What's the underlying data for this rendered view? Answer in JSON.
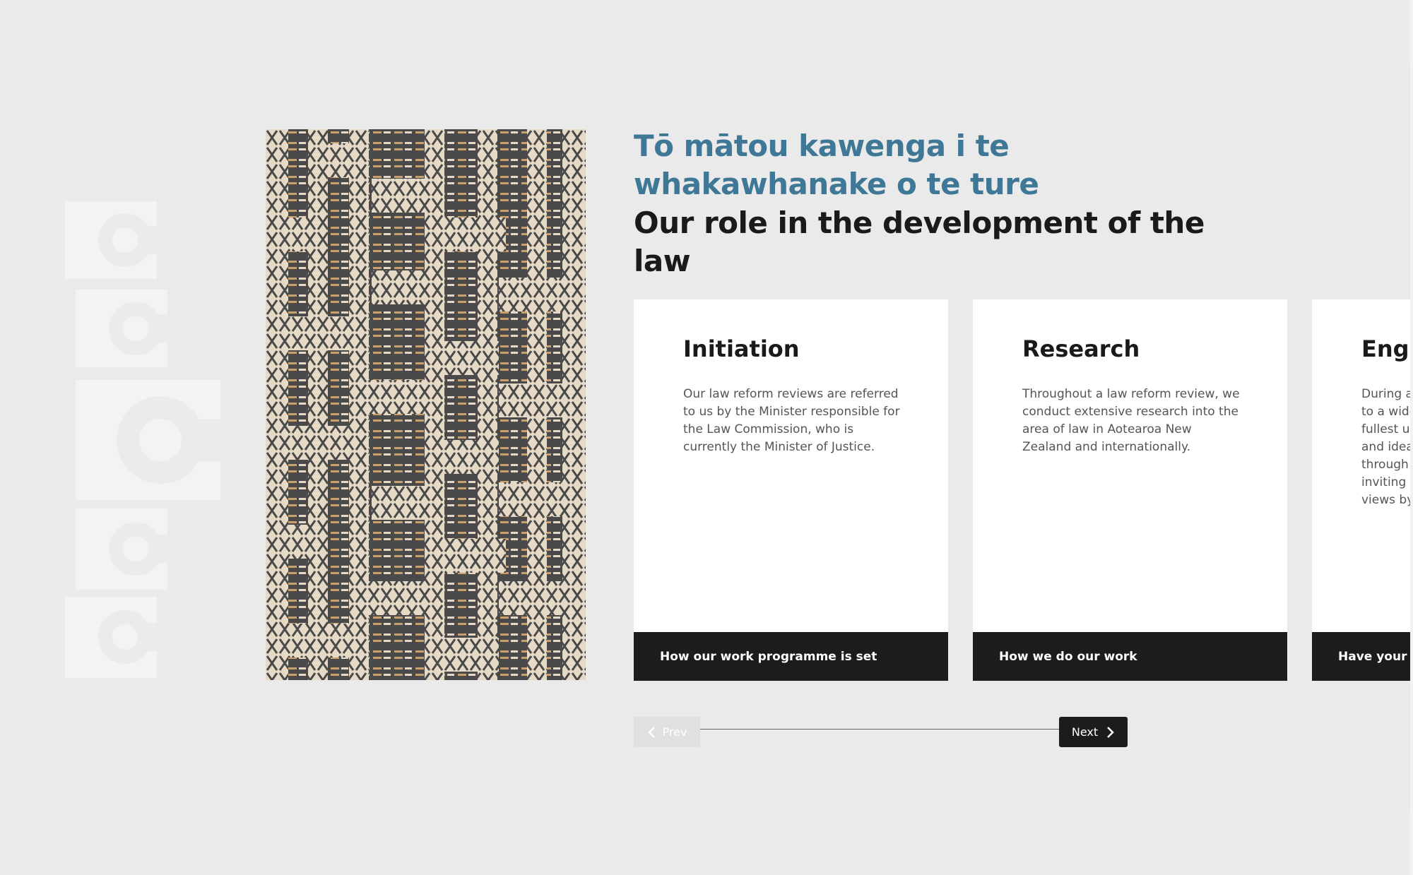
{
  "section": {
    "heading_maori": "Tō mātou kawenga i te whakawhanake o te ture",
    "heading_english": "Our role in the development of the law"
  },
  "cards": [
    {
      "title": "Initiation",
      "body": "Our law reform reviews are referred to us by the Minister responsible for the Law Commission, who is currently the Minister of Justice.",
      "link": "How our work programme is set"
    },
    {
      "title": "Research",
      "body": "Throughout a law reform review, we conduct extensive research into the area of law in Aotearoa New Zealand and internationally.",
      "link": "How we do our work"
    },
    {
      "title": "Enga",
      "body": "During a to a wide fullest ur and idea through inviting t views by",
      "link": "Have your sa"
    }
  ],
  "pager": {
    "prev_label": "Prev",
    "next_label": "Next"
  },
  "colors": {
    "background": "#ebebeb",
    "heading_maori": "#3f7896",
    "heading_english": "#1a1a1a",
    "card_link_bg": "#1c1c1c",
    "weave_dark": "#4a4a4a",
    "weave_light": "#e8dccb",
    "weave_accent": "#c8a070"
  },
  "icons": {
    "watermark": "law-commission-logo-watermark",
    "prev": "chevron-left-icon",
    "next": "chevron-right-icon"
  }
}
